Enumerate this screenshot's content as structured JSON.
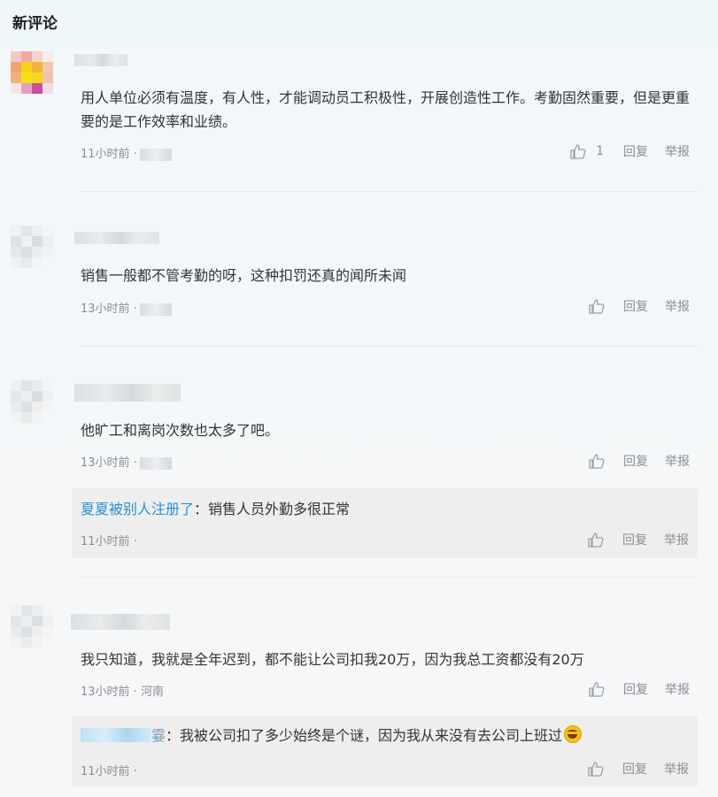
{
  "section_title": "新评论",
  "colors": {
    "accent": "#2c8fd6",
    "text": "#333333",
    "meta": "#8a8e93"
  },
  "actions": {
    "reply": "回复",
    "report": "举报"
  },
  "comments": [
    {
      "text": "用人单位必须有温度，有人性，才能调动员工积极性，开展创造性工作。考勤固然重要，但是更重要的是工作效率和业绩。",
      "time": "11小时前 ·",
      "likes": "1"
    },
    {
      "text": "销售一般都不管考勤的呀，这种扣罚还真的闻所未闻",
      "time": "13小时前 ·",
      "likes": ""
    },
    {
      "text": "他旷工和离岗次数也太多了吧。",
      "time": "13小时前 ·",
      "likes": "",
      "reply": {
        "author": "夏夏被别人注册了",
        "text": "：销售人员外勤多很正常",
        "time": "11小时前 ·"
      }
    },
    {
      "text": "我只知道，我就是全年迟到，都不能让公司扣我20万，因为我总工资都没有20万",
      "time": "13小时前 · 河南",
      "likes": "",
      "reply": {
        "author_suffix": "霎",
        "text": "：我被公司扣了多少始终是个谜，因为我从来没有去公司上班过",
        "time": "11小时前 ·"
      }
    }
  ]
}
